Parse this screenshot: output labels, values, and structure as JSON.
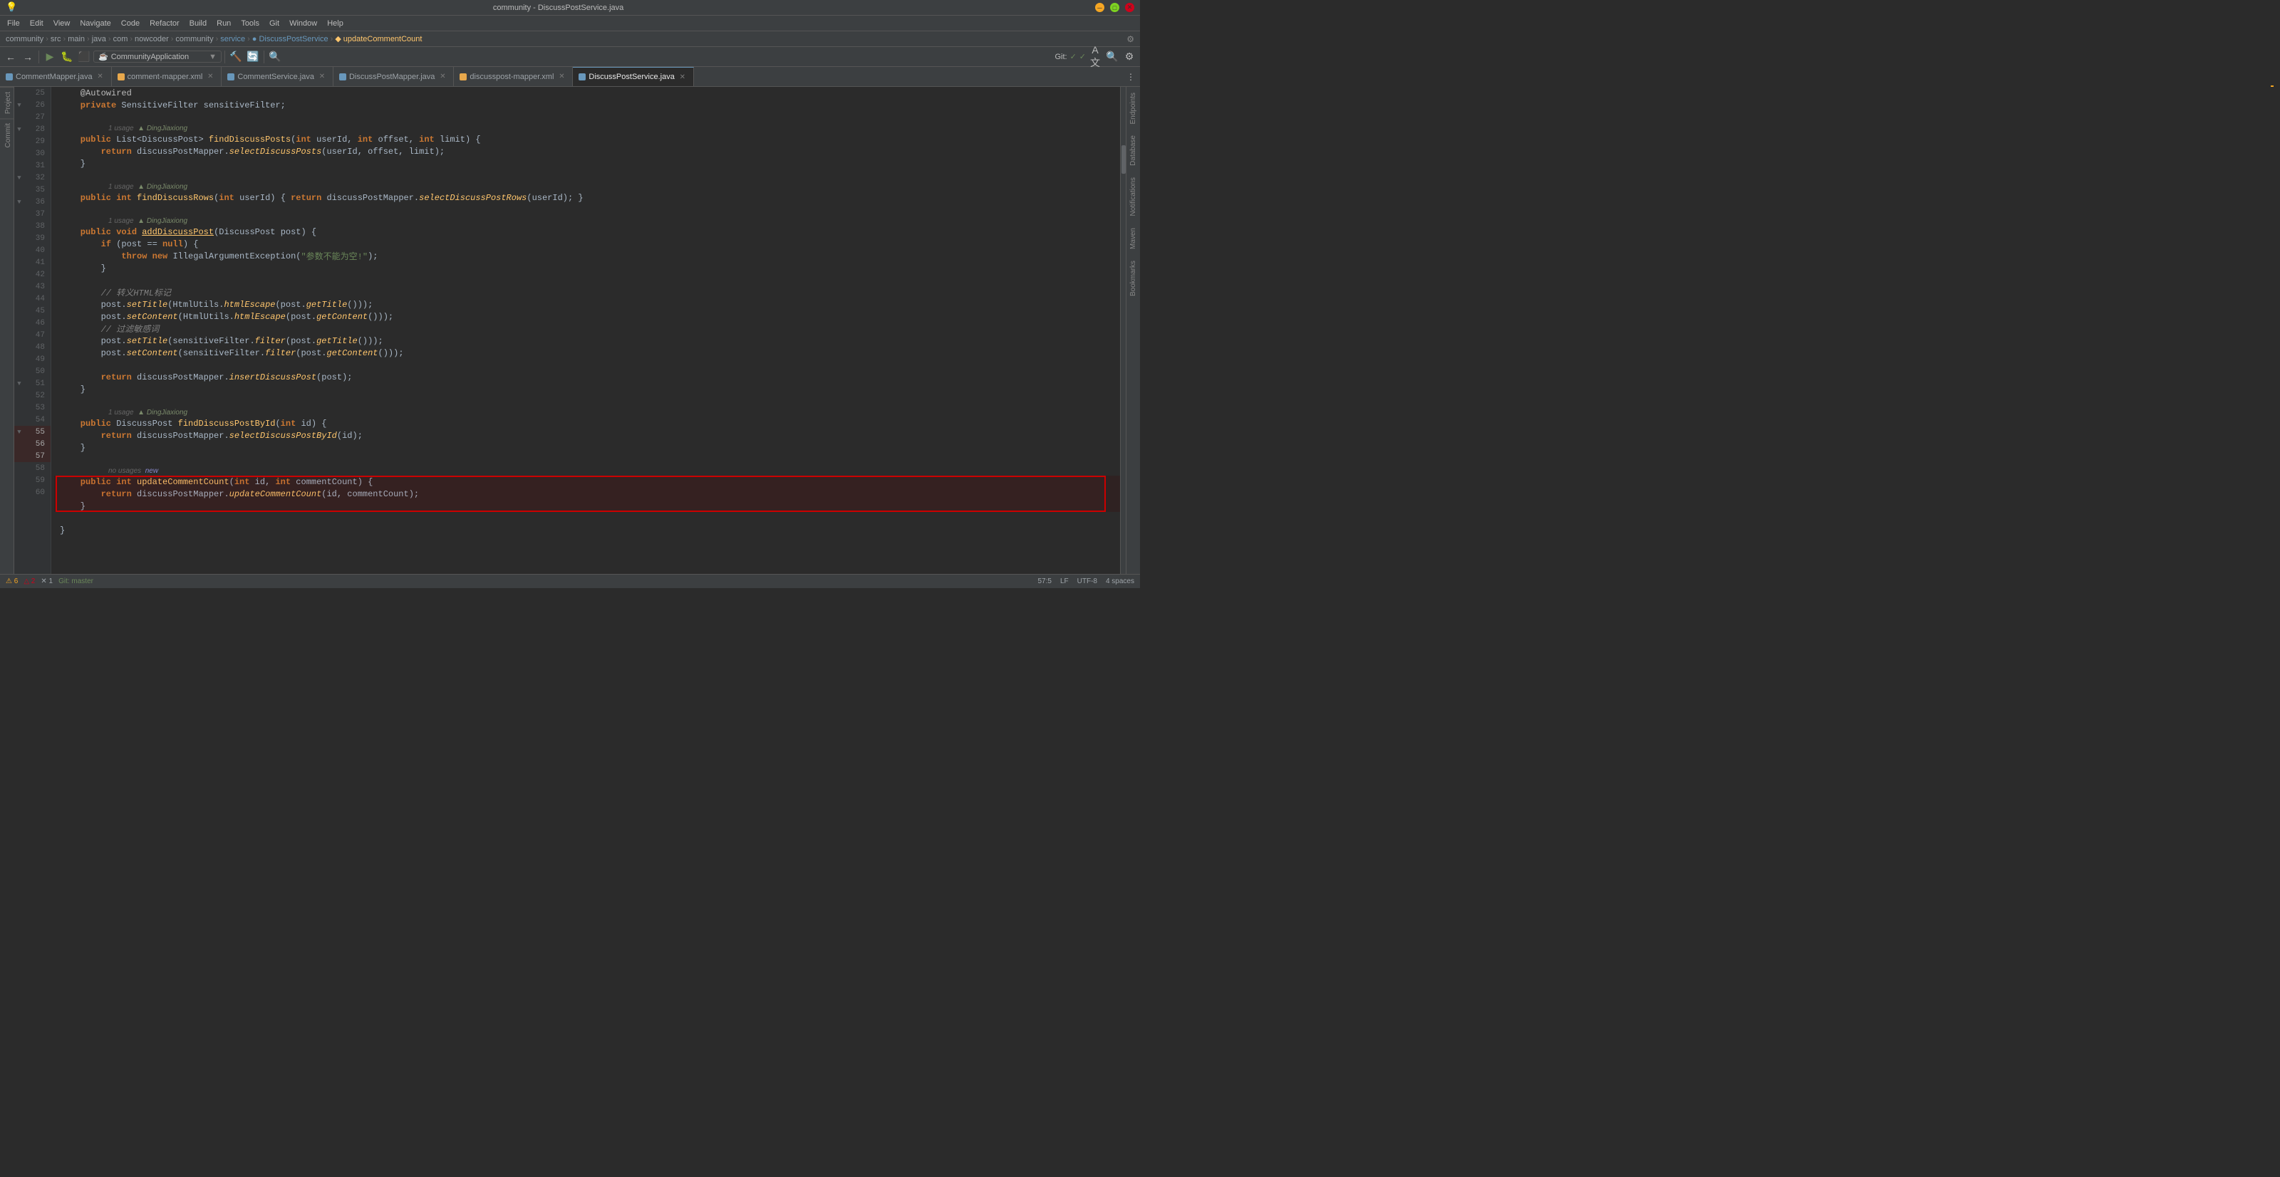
{
  "window": {
    "title": "community - DiscussPostService.java",
    "titlebar_icon": "💡"
  },
  "menubar": {
    "items": [
      "File",
      "Edit",
      "View",
      "Navigate",
      "Code",
      "Refactor",
      "Build",
      "Run",
      "Tools",
      "Git",
      "Window",
      "Help"
    ]
  },
  "breadcrumb": {
    "project": "community",
    "src": "src",
    "main": "main",
    "java": "java",
    "com": "com",
    "nowcoder": "nowcoder",
    "community2": "community",
    "service": "service",
    "class_icon": "●",
    "class_name": "DiscussPostService",
    "method_icon": "◆",
    "method_name": "updateCommentCount"
  },
  "toolbar": {
    "run_config_label": "CommunityApplication",
    "git_label": "Git:",
    "git_checkmark1": "✓",
    "git_checkmark2": "✓"
  },
  "tabs": [
    {
      "label": "CommentMapper.java",
      "icon_color": "#6897bb",
      "active": false,
      "modified": false
    },
    {
      "label": "comment-mapper.xml",
      "icon_color": "#e8a84c",
      "active": false,
      "modified": false
    },
    {
      "label": "CommentService.java",
      "icon_color": "#6897bb",
      "active": false,
      "modified": false
    },
    {
      "label": "DiscussPostMapper.java",
      "icon_color": "#6897bb",
      "active": false,
      "modified": false
    },
    {
      "label": "discusspost-mapper.xml",
      "icon_color": "#e8a84c",
      "active": false,
      "modified": false
    },
    {
      "label": "DiscussPostService.java",
      "icon_color": "#6897bb",
      "active": true,
      "modified": false
    }
  ],
  "right_panel": {
    "tabs": [
      "Endpoints",
      "Database",
      "Notifications",
      "Maven",
      "Bookmarks"
    ]
  },
  "left_tabs": {
    "items": [
      "Project",
      "Commit"
    ]
  },
  "code_lines": [
    {
      "num": 25,
      "content": "    @Autowired",
      "type": "annotation_line"
    },
    {
      "num": 26,
      "content": "    private SensitiveFilter sensitiveFilter;",
      "type": "field_line"
    },
    {
      "num": 27,
      "content": "",
      "type": "blank"
    },
    {
      "num": 28,
      "content": "    public List<DiscussPost> findDiscussPosts(int userId, int offset, int limit) {",
      "type": "method_sig",
      "usage": "1 usage",
      "author": "DingJiaxiong"
    },
    {
      "num": 29,
      "content": "        return discussPostMapper.selectDiscussPosts(userId, offset, limit);",
      "type": "return"
    },
    {
      "num": 30,
      "content": "    }",
      "type": "brace"
    },
    {
      "num": 31,
      "content": "",
      "type": "blank"
    },
    {
      "num": 32,
      "content": "    public int findDiscussRows(int userId) { return discussPostMapper.selectDiscussPostRows(userId); }",
      "type": "oneliner",
      "usage": "1 usage",
      "author": "DingJiaxiong"
    },
    {
      "num": 35,
      "content": "",
      "type": "blank"
    },
    {
      "num": 36,
      "content": "    public void addDiscussPost(DiscussPost post) {",
      "type": "method_sig",
      "usage": "1 usage",
      "author": "DingJiaxiong"
    },
    {
      "num": 37,
      "content": "        if (post == null) {",
      "type": "if"
    },
    {
      "num": 38,
      "content": "            throw new IllegalArgumentException(\"参数不能为空!\");",
      "type": "throw"
    },
    {
      "num": 39,
      "content": "        }",
      "type": "brace"
    },
    {
      "num": 40,
      "content": "",
      "type": "blank"
    },
    {
      "num": 41,
      "content": "        // 转义HTML标记",
      "type": "comment"
    },
    {
      "num": 42,
      "content": "        post.setTitle(HtmlUtils.htmlEscape(post.getTitle()));",
      "type": "stmt"
    },
    {
      "num": 43,
      "content": "        post.setContent(HtmlUtils.htmlEscape(post.getContent()));",
      "type": "stmt"
    },
    {
      "num": 44,
      "content": "        // 过滤敏感词",
      "type": "comment"
    },
    {
      "num": 45,
      "content": "        post.setTitle(sensitiveFilter.filter(post.getTitle()));",
      "type": "stmt"
    },
    {
      "num": 46,
      "content": "        post.setContent(sensitiveFilter.filter(post.getContent()));",
      "type": "stmt"
    },
    {
      "num": 47,
      "content": "",
      "type": "blank"
    },
    {
      "num": 48,
      "content": "        return discussPostMapper.insertDiscussPost(post);",
      "type": "return"
    },
    {
      "num": 49,
      "content": "    }",
      "type": "brace"
    },
    {
      "num": 50,
      "content": "",
      "type": "blank"
    },
    {
      "num": 51,
      "content": "    public DiscussPost findDiscussPostById(int id) {",
      "type": "method_sig",
      "usage": "1 usage",
      "author": "DingJiaxiong"
    },
    {
      "num": 52,
      "content": "        return discussPostMapper.selectDiscussPostById(id);",
      "type": "return"
    },
    {
      "num": 53,
      "content": "    }",
      "type": "brace"
    },
    {
      "num": 54,
      "content": "",
      "type": "blank"
    },
    {
      "num": 55,
      "content": "    public int updateCommentCount(int id, int commentCount) {",
      "type": "method_sig_highlight",
      "usage": "no usages",
      "badge": "new"
    },
    {
      "num": 56,
      "content": "        return discussPostMapper.updateCommentCount(id, commentCount);",
      "type": "return_highlight"
    },
    {
      "num": 57,
      "content": "    }",
      "type": "brace_highlight"
    },
    {
      "num": 58,
      "content": "",
      "type": "blank"
    },
    {
      "num": 59,
      "content": "}",
      "type": "brace"
    },
    {
      "num": 60,
      "content": "",
      "type": "blank"
    }
  ],
  "status_bar": {
    "warnings": "⚠ 6",
    "errors": "△ 2",
    "info": "✕ 1",
    "git_branch": "Git: master",
    "encoding": "UTF-8",
    "line_sep": "LF",
    "indent": "4 spaces",
    "position": "57:5"
  }
}
